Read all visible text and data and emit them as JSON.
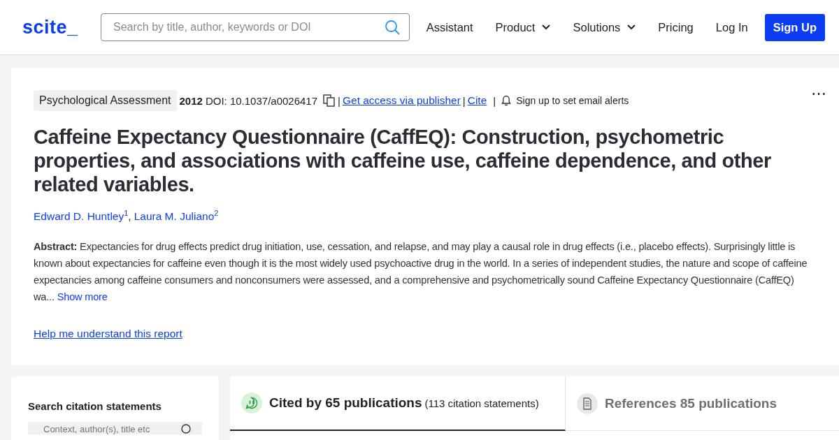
{
  "header": {
    "logo": "scite_",
    "search": {
      "placeholder": "Search by title, author, keywords or DOI"
    },
    "nav": [
      {
        "label": "Assistant",
        "kind": "link"
      },
      {
        "label": "Product",
        "kind": "dropdown"
      },
      {
        "label": "Solutions",
        "kind": "dropdown"
      },
      {
        "label": "Pricing",
        "kind": "link"
      },
      {
        "label": "Log In",
        "kind": "link"
      },
      {
        "label": "Sign Up",
        "kind": "primary"
      }
    ]
  },
  "paper": {
    "journal": "Psychological Assessment",
    "year": "2012",
    "doi": "DOI: 10.1037/a0026417",
    "access_link": "Get access via publisher",
    "cite_link": "Cite",
    "separator": "|",
    "alerts": "Sign up to set email alerts",
    "more": "⋯",
    "title": "Caffeine Expectancy Questionnaire (CaffEQ): Construction, psychometric properties, and associations with caffeine use, caffeine dependence, and other related variables.",
    "authors": [
      "Edward D. Huntley$^{1}$",
      "Laura M. Juliano$^{2}$"
    ],
    "author_separator": ",",
    "abstract": "**Abstract:** Expectancies for drug effects predict drug initiation, use, cessation, and relapse, and may play a causal role in drug effects (i.e., placebo effects). Surprisingly little is known about expectancies for caffeine even though it is the most widely used psychoactive drug in the world. In a series of independent studies, the nature and scope of caffeine expectancies among caffeine consumers and nonconsumers were assessed, and a comprehensive and psychometrically sound Caffeine Expectancy Questionnaire (CaffEQ) wa...",
    "show_more": "Show more",
    "help_link": "Help me understand this report"
  },
  "citation_search": {
    "heading": "Search citation statements",
    "placeholder": "Context, author(s), title etc"
  },
  "tabs": [
    {
      "kind": "cited",
      "label": "Cited by 65 publications",
      "detail": "(113 citation statements)",
      "selected": true
    },
    {
      "kind": "references",
      "label": "References 85 publications",
      "selected": false
    }
  ]
}
